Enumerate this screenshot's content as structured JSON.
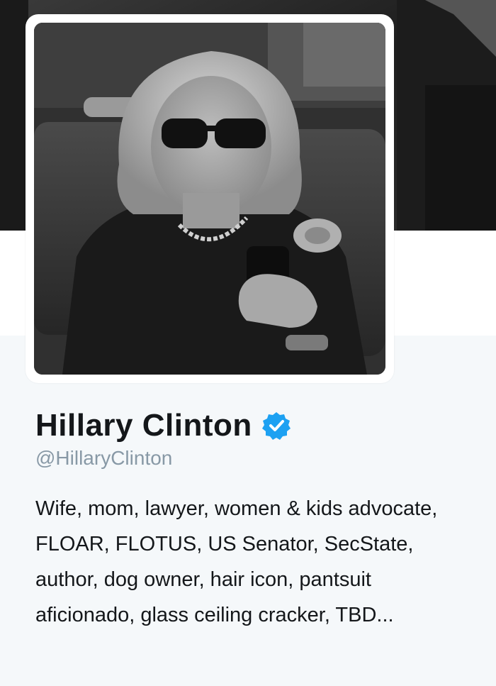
{
  "profile": {
    "name": "Hillary Clinton",
    "handle": "@HillaryClinton",
    "verified": true,
    "bio": "Wife, mom, lawyer, women & kids advocate, FLOAR, FLOTUS, US Senator, SecState, author, dog owner, hair icon, pantsuit aficionado, glass ceiling cracker, TBD...",
    "avatar_icon": "profile-photo",
    "banner_icon": "header-photo"
  },
  "colors": {
    "verified_badge": "#1da1f2",
    "name_text": "#14171a",
    "handle_text": "#8899a6",
    "background": "#f5f8fa"
  }
}
